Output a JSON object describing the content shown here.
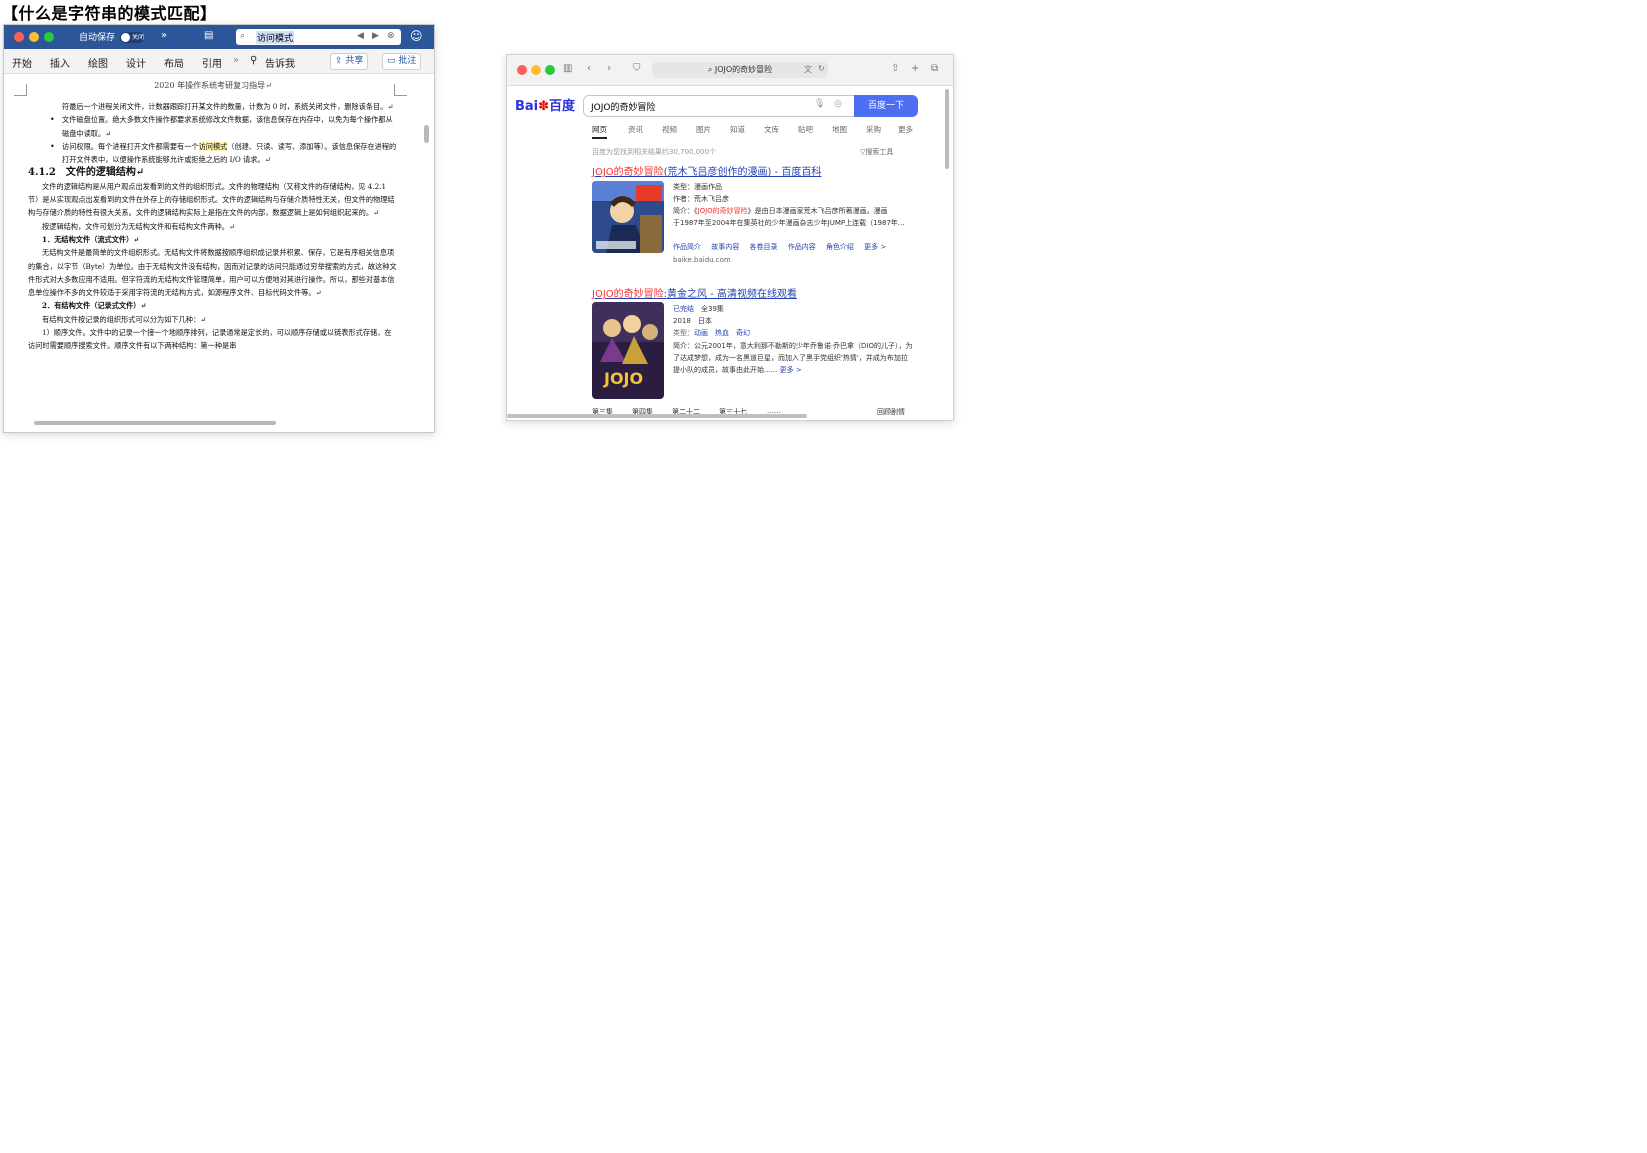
{
  "heading": "【什么是字符串的模式匹配】",
  "word": {
    "colors": {
      "titlebar": "#2b579a",
      "close": "#ff5f57",
      "minimize": "#febc2e",
      "zoom": "#28c840"
    },
    "autosave_label": "自动保存",
    "autosave_state": "关闭",
    "search_query": "访问模式",
    "ribbon_tabs": [
      "开始",
      "插入",
      "绘图",
      "设计",
      "布局",
      "引用"
    ],
    "more_label": "»",
    "tell_me": "告诉我",
    "share_label": "共享",
    "comment_label": "批注",
    "page_header": "2020 年操作系统考研复习指导↵",
    "para_top": "符最后一个进程关闭文件，计数器跟踪打开某文件的数量，计数为 0 时，系统关闭文件，删除该条目。↵",
    "bullet1": "文件磁盘位置。绝大多数文件操作都要求系统修改文件数据，该信息保存在内存中，以免为每个操作都从磁盘中读取。↵",
    "bullet2_pre": "访问权限。每个进程打开文件都需要有一个",
    "bullet2_hl": "访问模式",
    "bullet2_post": "（创建、只读、读写、添加等）。该信息保存在进程的打开文件表中，以便操作系统能够允许或拒绝之后的 I/O 请求。↵",
    "section_title": "4.1.2　文件的逻辑结构↵",
    "para_logic": "文件的逻辑结构是从用户观点出发看到的文件的组织形式。文件的物理结构（又称文件的存储结构，见 4.2.1 节）是从实现观点出发看到的文件在外存上的存储组织形式。文件的逻辑结构与存储介质特性无关，但文件的物理结构与存储介质的特性有很大关系。文件的逻辑结构实际上是指在文件的内部，数据逻辑上是如何组织起来的。↵",
    "para_classify": "按逻辑结构，文件可划分为无结构文件和有结构文件两种。↵",
    "sub1": "1．无结构文件（流式文件）↵",
    "para_sub1": "无结构文件是最简单的文件组织形式。无结构文件将数据按顺序组织成记录并积累、保存，它是有序相关信息项的集合，以字节（Byte）为单位。由于无结构文件没有结构，因而对记录的访问只能通过穷举搜索的方式，故这种文件形式对大多数应用不适用。但字符流的无结构文件管理简单，用户可以方便地对其进行操作。所以，那些对基本信息单位操作不多的文件较适于采用字符流的无结构方式，如源程序文件、目标代码文件等。↵",
    "sub2": "2．有结构文件（记录式文件）↵",
    "para_sub2": "有结构文件按记录的组织形式可以分为如下几种：↵",
    "para_seq": "1）顺序文件。文件中的记录一个接一个地顺序排列，记录通常是定长的，可以顺序存储或以链表形式存储，在访问时需要顺序搜索文件。顺序文件有以下两种结构：第一种是串"
  },
  "safari": {
    "address": "JOJO的奇妙冒险",
    "baidu_logo_latin": "Bai",
    "baidu_logo_cn": "百度",
    "search_query": "JOJO的奇妙冒险",
    "search_button": "百度一下",
    "tabs": [
      "网页",
      "资讯",
      "视频",
      "图片",
      "知道",
      "文库",
      "贴吧",
      "地图",
      "采购",
      "更多"
    ],
    "result_count": "百度为您找到相关结果约30,700,000个",
    "search_tools": "搜索工具",
    "result1": {
      "title_red": "JOJO的奇妙冒险",
      "title_rest": "(荒木飞吕彦创作的漫画) - 百度百科",
      "line1": "类型：漫画作品",
      "line2": "作者：荒木飞吕彦",
      "line3_pre": "简介：《",
      "line3_red": "JOJO的奇妙冒险",
      "line3_post": "》是由日本漫画家荒木飞吕彦所著漫画。漫画",
      "line4": "于1987年至2004年在集英社的少年漫画杂志少年JUMP上连载（1987年...",
      "links": [
        "作品简介",
        "故事内容",
        "各卷目录",
        "作品内容",
        "角色介绍",
        "更多 >"
      ],
      "source": "baike.baidu.com"
    },
    "result2": {
      "title_red": "JOJO的奇妙冒险",
      "title_rest": ":黄金之风 - 高清视频在线观看",
      "status": "已完结",
      "episodes": "全39集",
      "year_region": "2018　日本",
      "genres_label": "类型：",
      "genres": [
        "动画",
        "热血",
        "奇幻"
      ],
      "desc": "简介：公元2001年，意大利那不勒斯的少年乔鲁诺·乔巴拿（DIO的儿子），为了达成梦想，成为一名黑道巨星，而加入了黑手党组织'热情'，并成为布加拉提小队的成员，故事由此开始......",
      "more": "更多 >"
    },
    "episodes": [
      "第三集",
      "第四集",
      "第二十二",
      "第三十七",
      "……",
      "回顾剧情"
    ],
    "colors": {
      "baidu_blue": "#4e6ef2",
      "baidu_red": "#f73131",
      "link_blue": "#2440b3"
    }
  }
}
